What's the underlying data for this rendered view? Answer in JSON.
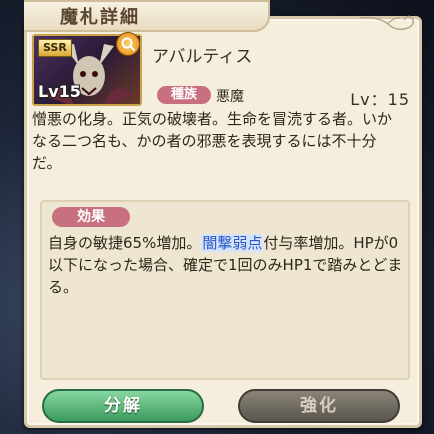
{
  "header": {
    "title": "魔札詳細"
  },
  "card": {
    "rarity": "SSR",
    "level_badge": "Lv15",
    "name": "アバルティス",
    "race_label": "種族",
    "race_value": "悪魔",
    "level_text": "Lv：15"
  },
  "description": "憎悪の化身。正気の破壊者。生命を冒涜する者。いかなる二つ名も、かの者の邪悪を表現するには不十分だ。",
  "effect": {
    "label": "効果",
    "text_before": "自身の敏捷65%増加。",
    "keyword": "闇撃弱点",
    "text_after": "付与率増加。HPが0以下になった場合、確定で1回のみHP1で踏みとどまる。"
  },
  "buttons": {
    "decompose": "分解",
    "enhance": "強化"
  },
  "colors": {
    "keyword": "#2a58c8",
    "pill": "#c87080",
    "decompose_button": "#3a9c5c",
    "enhance_button": "#5a564e"
  }
}
